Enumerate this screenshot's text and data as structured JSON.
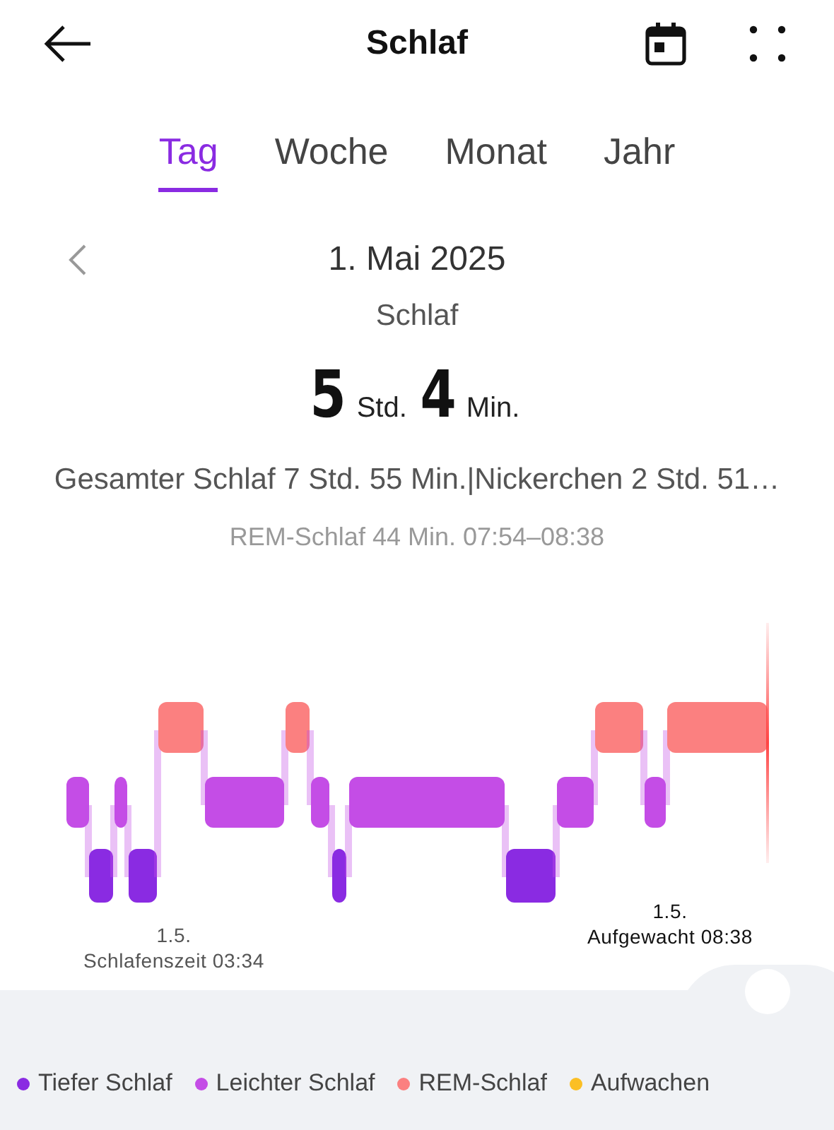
{
  "header": {
    "title": "Schlaf"
  },
  "tabs": [
    {
      "label": "Tag",
      "selected": true
    },
    {
      "label": "Woche",
      "selected": false
    },
    {
      "label": "Monat",
      "selected": false
    },
    {
      "label": "Jahr",
      "selected": false
    }
  ],
  "date": "1. Mai 2025",
  "section_label": "Schlaf",
  "duration": [
    {
      "value": "5",
      "unit": "Std."
    },
    {
      "value": "4",
      "unit": "Min."
    }
  ],
  "summary": "Gesamter Schlaf 7 Std. 55 Min.|Nickerchen 2 Std. 51…",
  "detail": "REM-Schlaf 44 Min. 07:54–08:38",
  "chart_labels": {
    "start_date": "1.5.",
    "start": "Schlafenszeit 03:34",
    "end_date": "1.5.",
    "end": "Aufgewacht 08:38"
  },
  "legend": [
    {
      "label": "Tiefer Schlaf",
      "color": "#8a2be2"
    },
    {
      "label": "Leichter Schlaf",
      "color": "#c44de6"
    },
    {
      "label": "REM-Schlaf",
      "color": "#fb8080"
    },
    {
      "label": "Aufwachen",
      "color": "#fbbf24"
    }
  ]
}
